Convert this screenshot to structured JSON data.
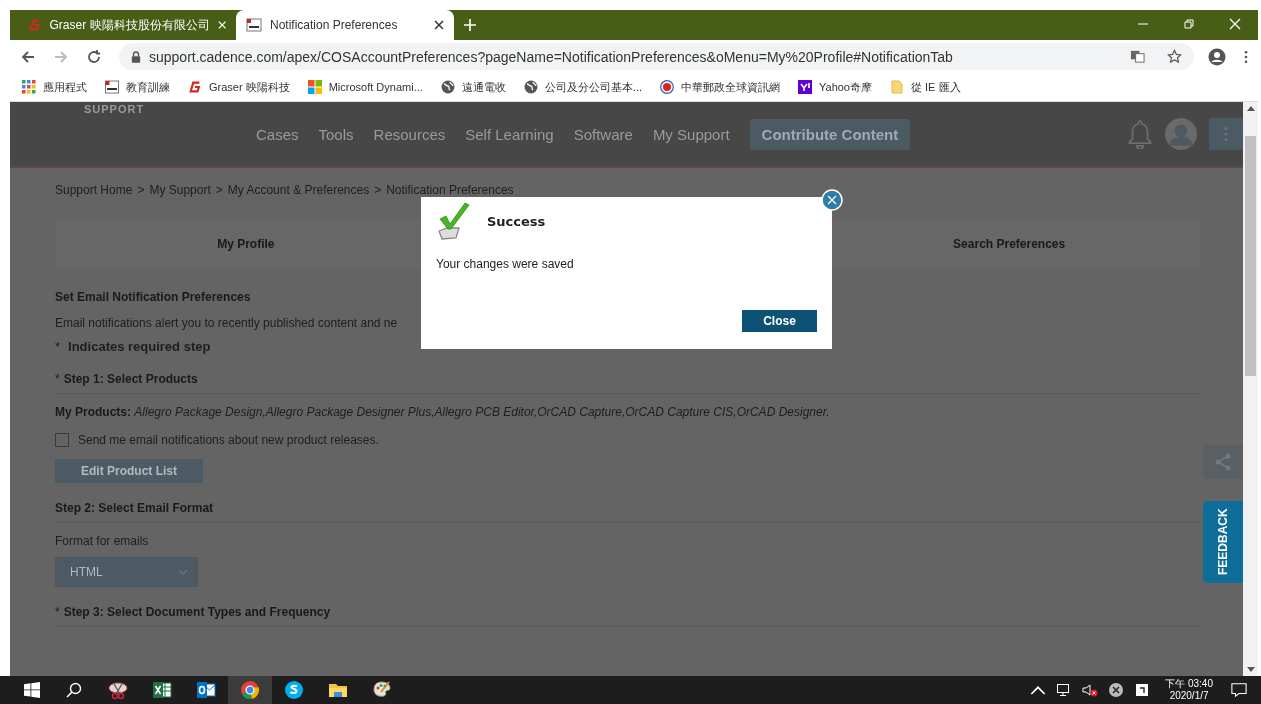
{
  "browser": {
    "tabs": [
      {
        "title": "Graser 映陽科技股份有限公司",
        "kind": "graser",
        "selected": false
      },
      {
        "title": "Notification Preferences",
        "kind": "cons",
        "selected": true
      }
    ],
    "address": "support.cadence.com/apex/COSAccountPreferences?pageName=NotificationPreferences&oMenu=My%20Profile#NotificationTab",
    "bookmarks": [
      {
        "label": "應用程式",
        "kind": "apps"
      },
      {
        "label": "教育訓練",
        "kind": "cons"
      },
      {
        "label": "Graser 映陽科技",
        "kind": "graser"
      },
      {
        "label": "Microsoft Dynami...",
        "kind": "ms"
      },
      {
        "label": "遠通電收",
        "kind": "globe"
      },
      {
        "label": "公司及分公司基本...",
        "kind": "globe"
      },
      {
        "label": "中華郵政全球資訊網",
        "kind": "post"
      },
      {
        "label": "Yahoo奇摩",
        "kind": "yahoo"
      },
      {
        "label": "從 IE 匯入",
        "kind": "folder"
      }
    ]
  },
  "site": {
    "logo": "SUPPORT",
    "nav": [
      "Cases",
      "Tools",
      "Resources",
      "Self Learning",
      "Software",
      "My Support"
    ],
    "cta": "Contribute Content"
  },
  "breadcrumb": {
    "separator": ">",
    "items": [
      "Support Home",
      "My Support",
      "My Account & Preferences",
      "Notification Preferences"
    ]
  },
  "profile_tabs": [
    {
      "label": "My Profile"
    },
    {
      "label": "Search Preferences"
    }
  ],
  "section": {
    "title": "Set Email Notification Preferences",
    "description": "Email notifications alert you to recently published content and ne",
    "required_mark": "*",
    "required_note": "Indicates required step"
  },
  "step1": {
    "title": "Step 1: Select Products",
    "required": true,
    "products_label": "My Products:",
    "products": "Allegro Package Design,Allegro Package Designer Plus,Allegro PCB Editor,OrCAD Capture,OrCAD Capture CIS,OrCAD Designer.",
    "checkbox": {
      "label": "Send me email notifications about new product releases.",
      "checked": false
    },
    "button": "Edit Product List"
  },
  "step2": {
    "title": "Step 2: Select Email Format",
    "required": false,
    "field_label": "Format for emails",
    "value": "HTML"
  },
  "step3": {
    "title": "Step 3: Select Document Types and Frequency",
    "required": true
  },
  "feedback": "FEEDBACK",
  "dialog": {
    "title": "Success",
    "message": "Your changes were saved",
    "button": "Close"
  },
  "taskbar": {
    "apps": [
      {
        "kind": "snip",
        "selected": false
      },
      {
        "kind": "excel",
        "selected": false
      },
      {
        "kind": "outlook",
        "selected": false
      },
      {
        "kind": "chrome",
        "selected": true
      },
      {
        "kind": "skype",
        "selected": false
      },
      {
        "kind": "folder",
        "selected": false
      },
      {
        "kind": "paint",
        "selected": false
      }
    ],
    "time": "下午 03:40",
    "date": "2020/1/7"
  }
}
